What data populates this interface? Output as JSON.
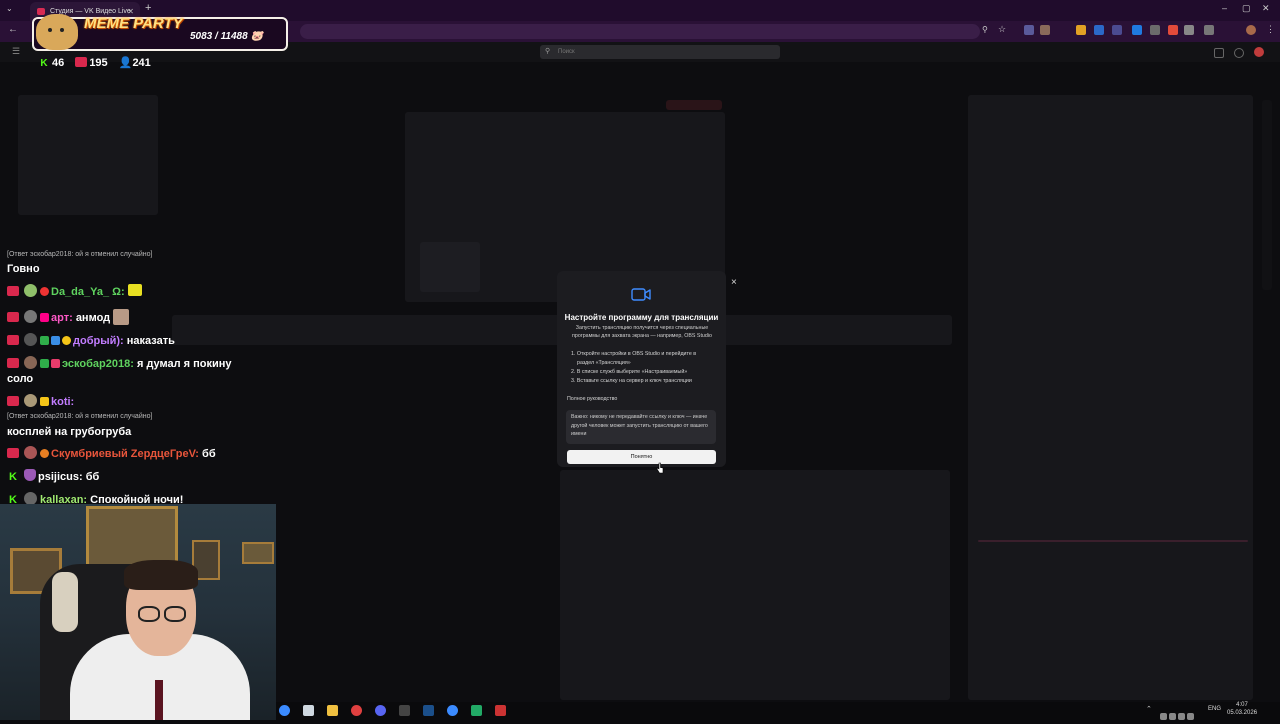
{
  "browser": {
    "tab_title": "Студия — VK Видео Live",
    "new_tab": "+",
    "window_minimize": "–",
    "window_maximize": "▢",
    "window_close": "✕"
  },
  "page": {
    "search_placeholder": "Поиск"
  },
  "meme_party": {
    "title": "MEME PARTY",
    "count": "5083 / 11488"
  },
  "stats": {
    "kick_count": "46",
    "live_count": "195",
    "viewers": "241"
  },
  "chat": {
    "reply1": "[Ответ эскобар2018: ой я отменил случайно]",
    "msg_govno": "Говно",
    "u1_name": "Da_da_Ya_ Ω:",
    "u2_name": "арт:",
    "u2_text": "анмод",
    "u3_name": "добрый):",
    "u3_text": "наказать",
    "u4_name": "эскобар2018:",
    "u4_text": "я думал я покину",
    "u4_text2": "соло",
    "u5_name": "koti:",
    "reply2": "[Ответ эскобар2018: ой я отменил случайно]",
    "msg_cosplay": "косплей на грубогруба",
    "u6_name": "Скумбриевый ZердцеГреV:",
    "u6_text": "бб",
    "u7_name": "psijicus:",
    "u7_text": "бб",
    "u8_name": "kallaxan:",
    "u8_text": "Спокойной ночи!"
  },
  "modal": {
    "close": "×",
    "title": "Настройте программу для трансляции",
    "desc": "Запустить трансляцию получится через специальные программы для захвата экрана — например, OBS Studio",
    "step1": "1. Откройте настройки в OBS Studio и перейдите в",
    "step1b": "раздел «Трансляция»",
    "step2": "2. В списке служб выберите «Настраиваемый»",
    "step3": "3. Вставьте ссылку на сервер и ключ трансляции",
    "guide": "Полное руководство",
    "warning": "Важно: никому не передавайте ссылку и ключ — иначе другой человек может запустить трансляцию от вашего имени",
    "ok_button": "Понятно"
  },
  "taskbar": {
    "lang": "ENG",
    "time": "4:07",
    "date": "05.03.2026"
  },
  "colors": {
    "live_red": "#d9284d",
    "kick_green": "#53fc18"
  }
}
